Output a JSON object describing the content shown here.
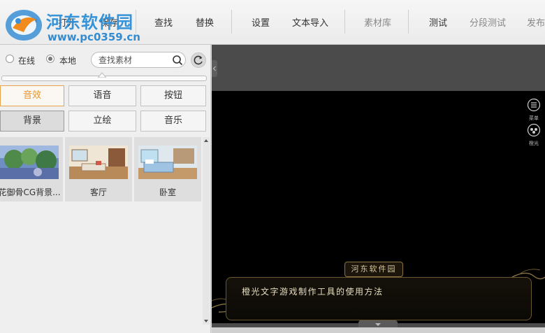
{
  "toolbar": {
    "items": [
      {
        "label": "新建"
      },
      {
        "label": "打开"
      },
      {
        "label": "保存"
      },
      {
        "label": "查找"
      },
      {
        "label": "替换"
      },
      {
        "label": "设置"
      },
      {
        "label": "文本导入"
      },
      {
        "label": "素材库"
      },
      {
        "label": "测试"
      },
      {
        "label": "分段测试"
      },
      {
        "label": "发布"
      }
    ]
  },
  "watermark": {
    "text": "河东软件园",
    "url": "www.pc0359.cn"
  },
  "left_panel": {
    "source": {
      "online_label": "在线",
      "local_label": "本地",
      "selected": "本地"
    },
    "search": {
      "placeholder": "查找素材"
    },
    "categories": [
      {
        "label": "音效",
        "state": "active"
      },
      {
        "label": "语音",
        "state": "normal"
      },
      {
        "label": "按钮",
        "state": "normal"
      },
      {
        "label": "背景",
        "state": "pressed"
      },
      {
        "label": "立绘",
        "state": "normal"
      },
      {
        "label": "音乐",
        "state": "normal"
      }
    ],
    "thumbnails": [
      {
        "label": "花御骨CG背景..."
      },
      {
        "label": "客厅"
      },
      {
        "label": "卧室"
      }
    ]
  },
  "stage": {
    "side_buttons": [
      {
        "label": "菜单",
        "icon": "menu-list-icon"
      },
      {
        "label": "橙光",
        "icon": "gamepad-icon"
      }
    ],
    "speaker_name": "河东软件园",
    "dialog_text": "橙光文字游戏制作工具的使用方法"
  },
  "colors": {
    "accent_orange": "#e8952b",
    "watermark_blue": "#2d8fd7",
    "stage_bg": "#000000",
    "dialog_gold": "#8a7340"
  }
}
